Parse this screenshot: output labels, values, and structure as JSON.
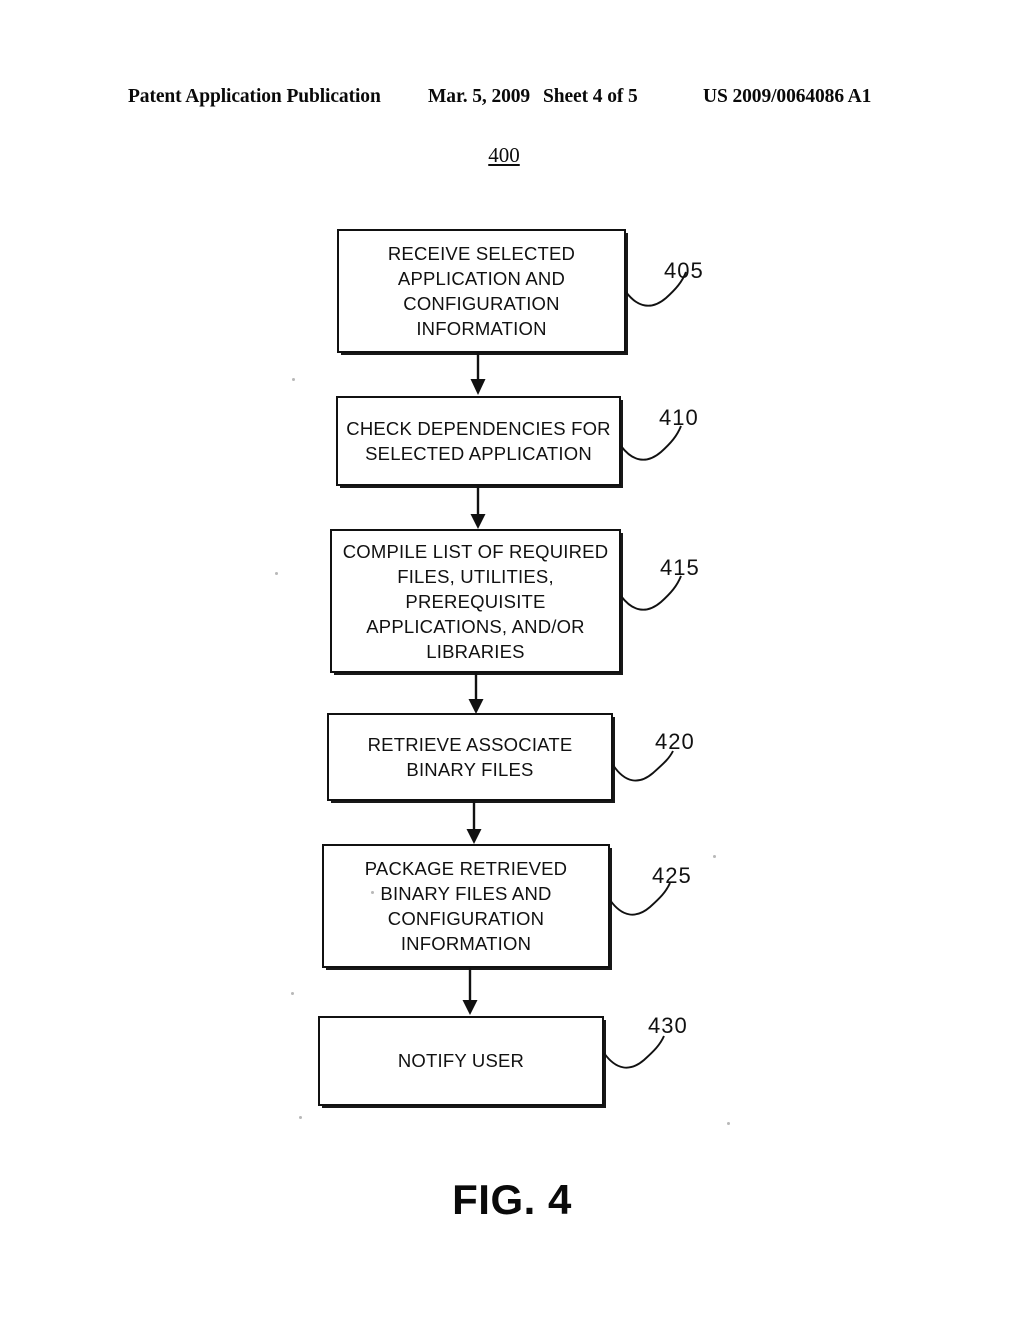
{
  "header": {
    "publication": "Patent Application Publication",
    "date": "Mar. 5, 2009",
    "sheet": "Sheet 4 of 5",
    "patent_number": "US 2009/0064086 A1"
  },
  "figure": {
    "diagram_ref": "400",
    "caption": "FIG. 4"
  },
  "flowchart": {
    "steps": [
      {
        "ref": "405",
        "text": "RECEIVE SELECTED\nAPPLICATION AND\nCONFIGURATION\nINFORMATION"
      },
      {
        "ref": "410",
        "text": "CHECK DEPENDENCIES FOR\nSELECTED APPLICATION"
      },
      {
        "ref": "415",
        "text": "COMPILE LIST OF REQUIRED\nFILES, UTILITIES,\nPREREQUISITE\nAPPLICATIONS, AND/OR\nLIBRARIES"
      },
      {
        "ref": "420",
        "text": "RETRIEVE ASSOCIATE\nBINARY FILES"
      },
      {
        "ref": "425",
        "text": "PACKAGE RETRIEVED\nBINARY FILES AND\nCONFIGURATION\nINFORMATION"
      },
      {
        "ref": "430",
        "text": "NOTIFY USER"
      }
    ]
  },
  "colors": {
    "ink": "#111111",
    "paper": "#ffffff"
  }
}
